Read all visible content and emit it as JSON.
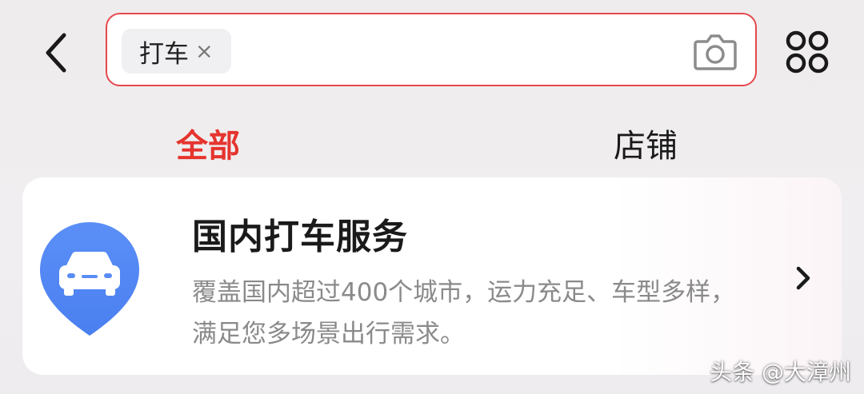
{
  "header": {
    "search": {
      "chip_label": "打车",
      "chip_close": "×"
    },
    "icons": {
      "back": "chevron-left-icon",
      "camera": "camera-icon",
      "menu": "four-dots-grid-icon"
    }
  },
  "tabs": [
    {
      "label": "全部",
      "active": true
    },
    {
      "label": "店铺",
      "active": false
    }
  ],
  "result_card": {
    "title": "国内打车服务",
    "description": "覆盖国内超过400个城市，运力充足、车型多样，满足您多场景出行需求。",
    "icon": "car-location-pin-icon"
  },
  "watermark": "头条 @大漳州",
  "colors": {
    "accent": "#e5342e",
    "search_border": "#e5484d",
    "pin_blue": "#4c86f5"
  }
}
